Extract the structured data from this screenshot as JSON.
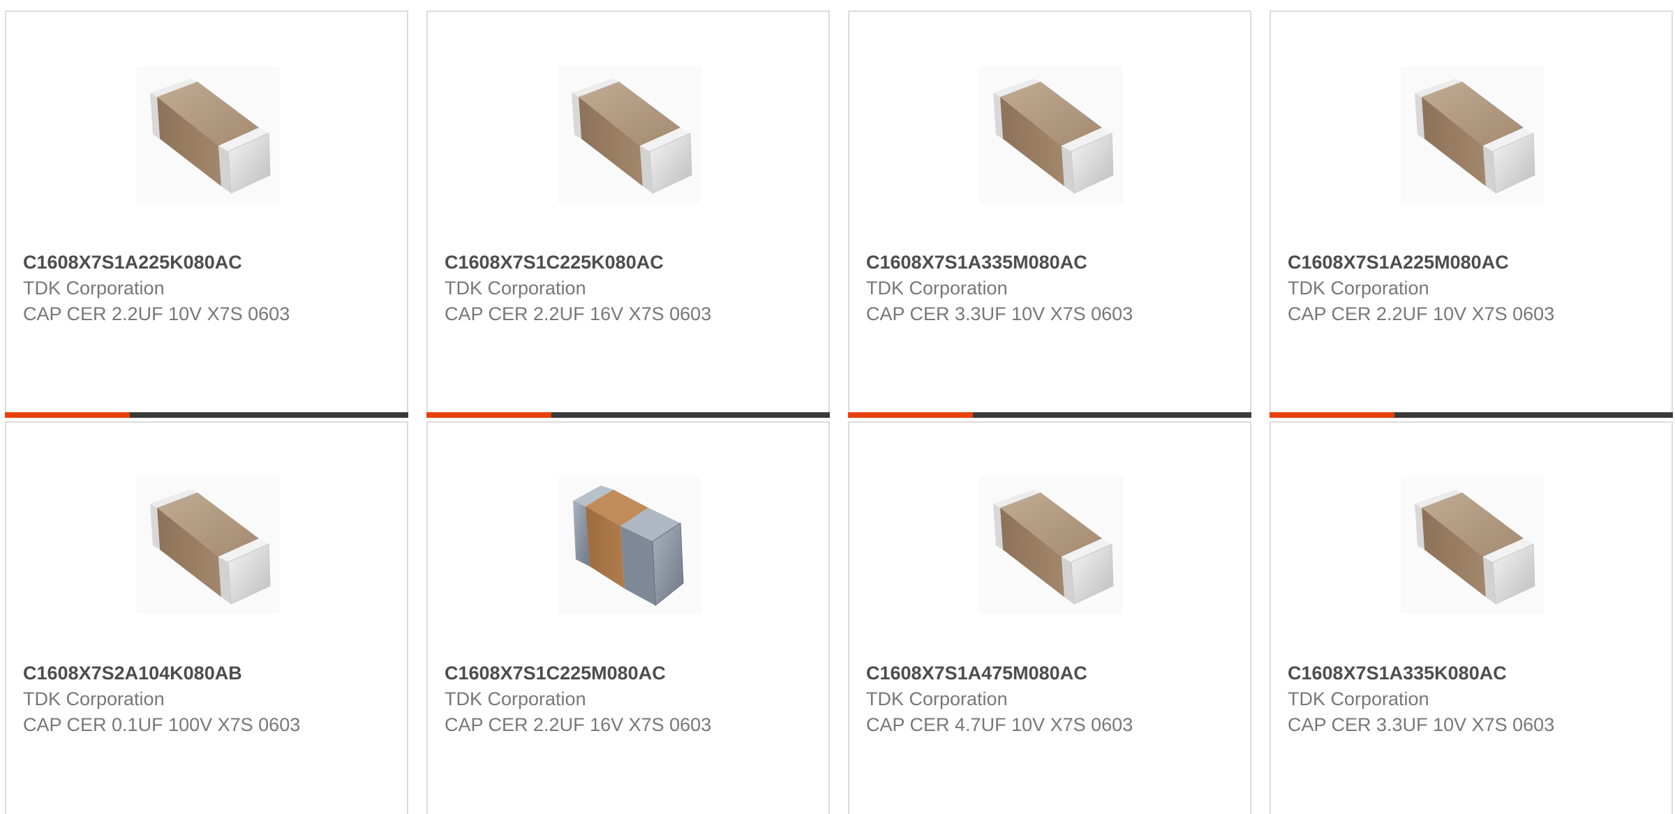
{
  "colors": {
    "accent": "#e8400c",
    "bar_track": "#3a3a3a",
    "part_number": "#4d4d4d",
    "secondary_text": "#777777",
    "card_border": "#dcdcdc"
  },
  "products": [
    {
      "part_number": "C1608X7S1A225K080AC",
      "manufacturer": "TDK Corporation",
      "description": "CAP CER 2.2UF 10V X7S 0603",
      "image_icon": "ceramic-capacitor-icon",
      "progress_fraction": 0.31,
      "show_progress": true
    },
    {
      "part_number": "C1608X7S1C225K080AC",
      "manufacturer": "TDK Corporation",
      "description": "CAP CER 2.2UF 16V X7S 0603",
      "image_icon": "ceramic-capacitor-icon",
      "progress_fraction": 0.31,
      "show_progress": true
    },
    {
      "part_number": "C1608X7S1A335M080AC",
      "manufacturer": "TDK Corporation",
      "description": "CAP CER 3.3UF 10V X7S 0603",
      "image_icon": "ceramic-capacitor-icon",
      "progress_fraction": 0.31,
      "show_progress": true
    },
    {
      "part_number": "C1608X7S1A225M080AC",
      "manufacturer": "TDK Corporation",
      "description": "CAP CER 2.2UF 10V X7S 0603",
      "image_icon": "ceramic-capacitor-icon",
      "progress_fraction": 0.31,
      "show_progress": true
    },
    {
      "part_number": "C1608X7S2A104K080AB",
      "manufacturer": "TDK Corporation",
      "description": "CAP CER 0.1UF 100V X7S 0603",
      "image_icon": "ceramic-capacitor-icon",
      "show_progress": false
    },
    {
      "part_number": "C1608X7S1C225M080AC",
      "manufacturer": "TDK Corporation",
      "description": "CAP CER 2.2UF 16V X7S 0603",
      "image_icon": "ceramic-capacitor-blue-icon",
      "show_progress": false
    },
    {
      "part_number": "C1608X7S1A475M080AC",
      "manufacturer": "TDK Corporation",
      "description": "CAP CER 4.7UF 10V X7S 0603",
      "image_icon": "ceramic-capacitor-icon",
      "show_progress": false
    },
    {
      "part_number": "C1608X7S1A335K080AC",
      "manufacturer": "TDK Corporation",
      "description": "CAP CER 3.3UF 10V X7S 0603",
      "image_icon": "ceramic-capacitor-icon",
      "show_progress": false
    }
  ]
}
